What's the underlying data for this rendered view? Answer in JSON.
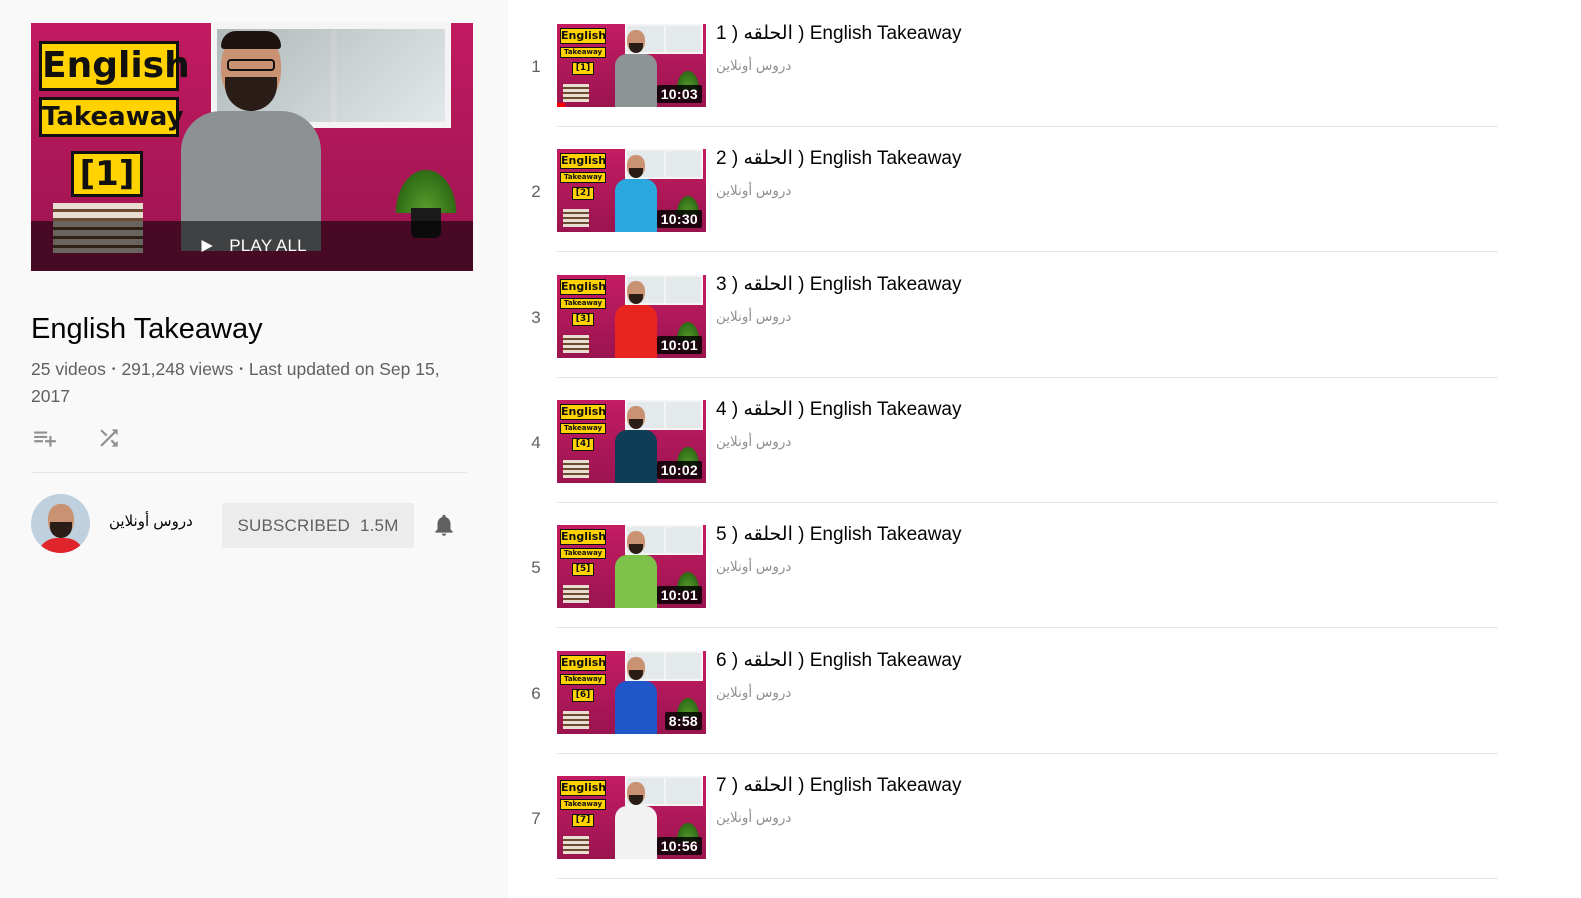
{
  "playlist": {
    "play_all_label": "PLAY ALL",
    "title": "English Takeaway",
    "video_count": "25 videos",
    "views": "291,248 views",
    "updated": "Last updated on Sep 15, 2017",
    "stats_separator": "•",
    "thumb_text": {
      "line1": "English",
      "line2": "Takeaway",
      "line3": "[1]"
    },
    "actions": {
      "save_icon": "playlist-add-icon",
      "shuffle_icon": "shuffle-icon"
    }
  },
  "owner": {
    "name": "دروس أونلاين",
    "subscribe_label": "SUBSCRIBED",
    "subscriber_count": "1.5M",
    "bell_icon": "bell-icon"
  },
  "videos": [
    {
      "index": "1",
      "title": "1 ) الحلقه ) English Takeaway",
      "channel": "دروس أونلاين",
      "duration": "10:03",
      "badge": "[1]",
      "shirt_color": "#8e9396"
    },
    {
      "index": "2",
      "title": "2 ) الحلقه ) English Takeaway",
      "channel": "دروس أونلاين",
      "duration": "10:30",
      "badge": "[2]",
      "shirt_color": "#2aa7dd"
    },
    {
      "index": "3",
      "title": "3 ) الحلقه ) English Takeaway",
      "channel": "دروس أونلاين",
      "duration": "10:01",
      "badge": "[3]",
      "shirt_color": "#e8241e"
    },
    {
      "index": "4",
      "title": "4 ) الحلقه ) English Takeaway",
      "channel": "دروس أونلاين",
      "duration": "10:02",
      "badge": "[4]",
      "shirt_color": "#0e3d56"
    },
    {
      "index": "5",
      "title": "5 ) الحلقه ) English Takeaway",
      "channel": "دروس أونلاين",
      "duration": "10:01",
      "badge": "[5]",
      "shirt_color": "#7cc24a"
    },
    {
      "index": "6",
      "title": "6 ) الحلقه ) English Takeaway",
      "channel": "دروس أونلاين",
      "duration": "8:58",
      "badge": "[6]",
      "shirt_color": "#1f57c9"
    },
    {
      "index": "7",
      "title": "7 ) الحلقه ) English Takeaway",
      "channel": "دروس أونلاين",
      "duration": "10:56",
      "badge": "[7]",
      "shirt_color": "#f2f2f2"
    }
  ],
  "thumb_labels": {
    "line1": "English",
    "line2": "Takeaway"
  },
  "colors": {
    "brand_magenta": "#b5195a",
    "badge_yellow": "#ffd200",
    "progress_red": "#ff0000"
  }
}
